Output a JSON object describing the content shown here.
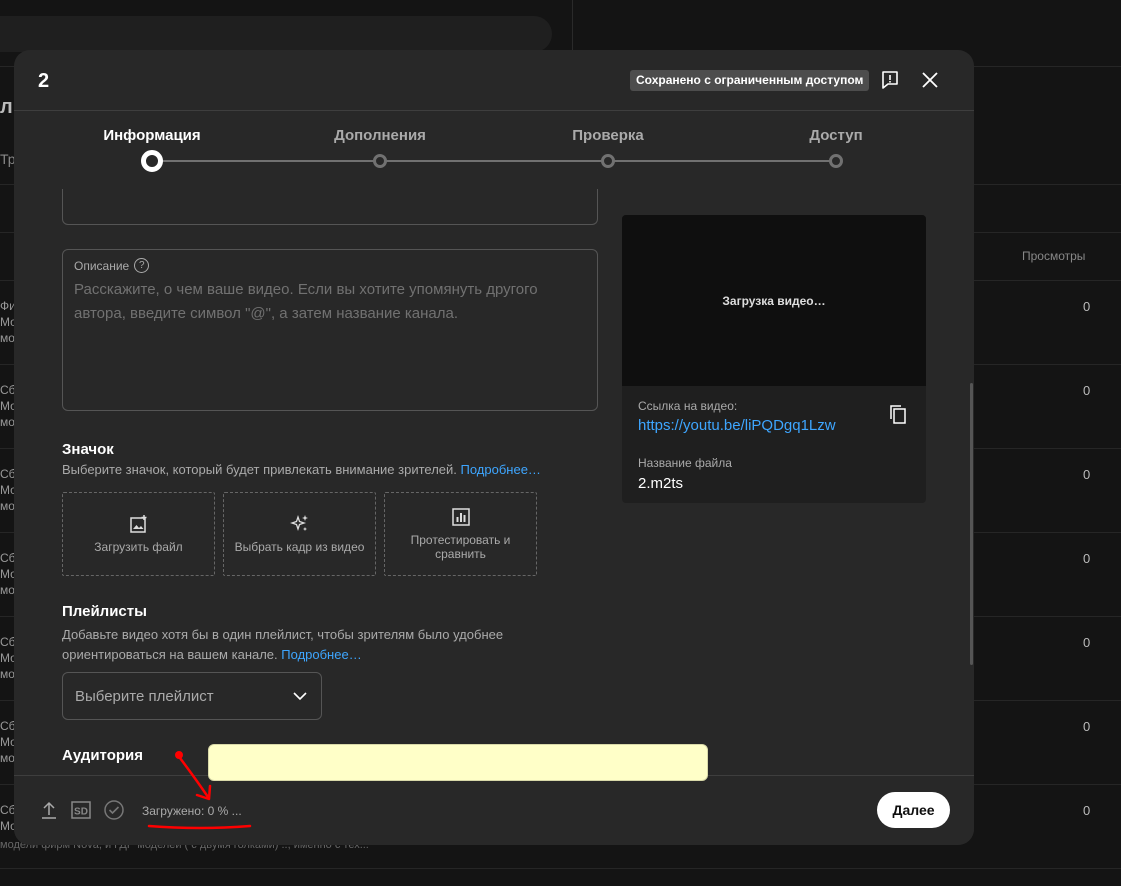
{
  "background": {
    "title_fragment": "л",
    "tab_fragment": "Тр",
    "views_header": "Просмотры",
    "rows": [
      {
        "line1": "Фи",
        "line2": "Мо",
        "line3": "мо",
        "views": "0"
      },
      {
        "line1": "Сб",
        "line2": "Мо",
        "line3": "мо",
        "views": "0"
      },
      {
        "line1": "Сб",
        "line2": "Мо",
        "line3": "мо",
        "views": "0"
      },
      {
        "line1": "Сб",
        "line2": "Мо",
        "line3": "мо",
        "views": "0"
      },
      {
        "line1": "Сб",
        "line2": "Мо",
        "line3": "мо",
        "views": "0"
      },
      {
        "line1": "Сб",
        "line2": "Мо",
        "line3": "мо",
        "views": "0"
      },
      {
        "line1": "Сб",
        "line2": "Мо",
        "line3": "",
        "views": "0"
      }
    ],
    "bottom_snippet": "модели фирм Nova, и ГДР моделей ( с двумя голками) .., именно с тех..."
  },
  "dialog": {
    "title": "2",
    "saved_badge": "Сохранено с ограниченным доступом",
    "steps": [
      {
        "label": "Информация",
        "active": true
      },
      {
        "label": "Дополнения",
        "active": false
      },
      {
        "label": "Проверка",
        "active": false
      },
      {
        "label": "Доступ",
        "active": false
      }
    ],
    "description": {
      "label": "Описание",
      "placeholder": "Расскажите, о чем ваше видео. Если вы хотите упомянуть другого автора, введите символ \"@\", а затем название канала."
    },
    "thumbnail": {
      "heading": "Значок",
      "text": "Выберите значок, который будет привлекать внимание зрителей.",
      "more": "Подробнее…",
      "options": [
        {
          "label": "Загрузить файл",
          "icon": "image-add-icon"
        },
        {
          "label": "Выбрать кадр из видео",
          "icon": "sparkle-icon"
        },
        {
          "label": "Протестировать и сравнить",
          "icon": "chart-icon"
        }
      ]
    },
    "playlists": {
      "heading": "Плейлисты",
      "text": "Добавьте видео хотя бы в один плейлист, чтобы зрителям было удобнее ориентироваться на вашем канале.",
      "more": "Подробнее…",
      "select_placeholder": "Выберите плейлист"
    },
    "audience": {
      "heading": "Аудитория"
    },
    "preview": {
      "status": "Загрузка видео…",
      "link_label": "Ссылка на видео:",
      "link": "https://youtu.be/liPQDgq1Lzw",
      "filename_label": "Название файла",
      "filename": "2.m2ts"
    },
    "footer": {
      "status": "Загружено: 0 % ...",
      "sd_badge": "SD",
      "next_label": "Далее"
    }
  },
  "colors": {
    "accent_link": "#3ea6ff",
    "annotation_red": "#ff0000",
    "highlight_yellow": "#ffffc8"
  }
}
